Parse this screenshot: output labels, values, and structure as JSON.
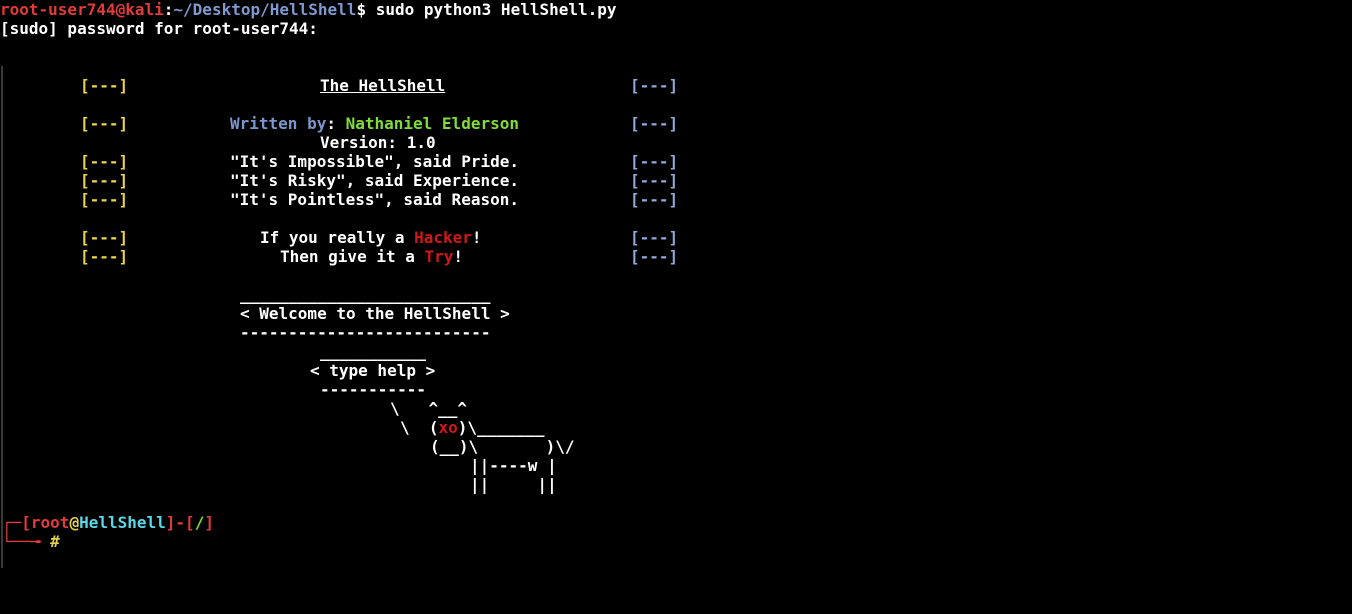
{
  "colors": {
    "background": "#000000",
    "prompt_user": "#e03a3a",
    "prompt_path": "#7f99d0",
    "bracket_left": "#e8d24a",
    "bracket_right": "#8fa8d8",
    "author": "#7fdc3a",
    "accent_red": "#d01818",
    "host_cyan": "#5ad8e8"
  },
  "shell": {
    "user_host": "root-user744@kali",
    "colon": ":",
    "path": "~/Desktop/HellShell",
    "dollar": "$ ",
    "command": "sudo python3 HellShell.py",
    "sudo_prompt": "[sudo] password for root-user744:"
  },
  "banner": {
    "bracket": "[---]",
    "title": "The HellShell",
    "written_by_label": "Written by",
    "colon": ": ",
    "author": "Nathaniel Elderson",
    "version": "Version: 1.0",
    "quotes": [
      "\"It's Impossible\", said Pride.",
      "\"It's Risky\", said Experience.",
      "\"It's Pointless\", said Reason."
    ],
    "hacker_pre": "If you really a ",
    "hacker_word": "Hacker",
    "hacker_post": "!",
    "try_pre": "Then give it a ",
    "try_word": "Try",
    "try_post": "!"
  },
  "cowsay": {
    "welcome_top": "__________________________",
    "welcome_text": "< Welcome to the HellShell >",
    "welcome_bottom": "--------------------------",
    "help_top": "___________",
    "help_text": "< type help >",
    "help_bottom": "-----------",
    "cow1": "\\   ^__^",
    "cow2_pre": "\\  (",
    "cow2_eyes": "xo",
    "cow2_post": ")\\_______",
    "cow3": "(__)\\       )\\/",
    "cow4": "||----w |",
    "cow5": "||     ||"
  },
  "hellshell_prompt": {
    "corner_top": "┌─",
    "open_bracket": "[",
    "user": "root",
    "at": "@",
    "host": "HellShell",
    "mid": "]-[",
    "dir": "/",
    "close_bracket": "]",
    "corner_bottom": "└──╼ ",
    "hash": "#"
  }
}
